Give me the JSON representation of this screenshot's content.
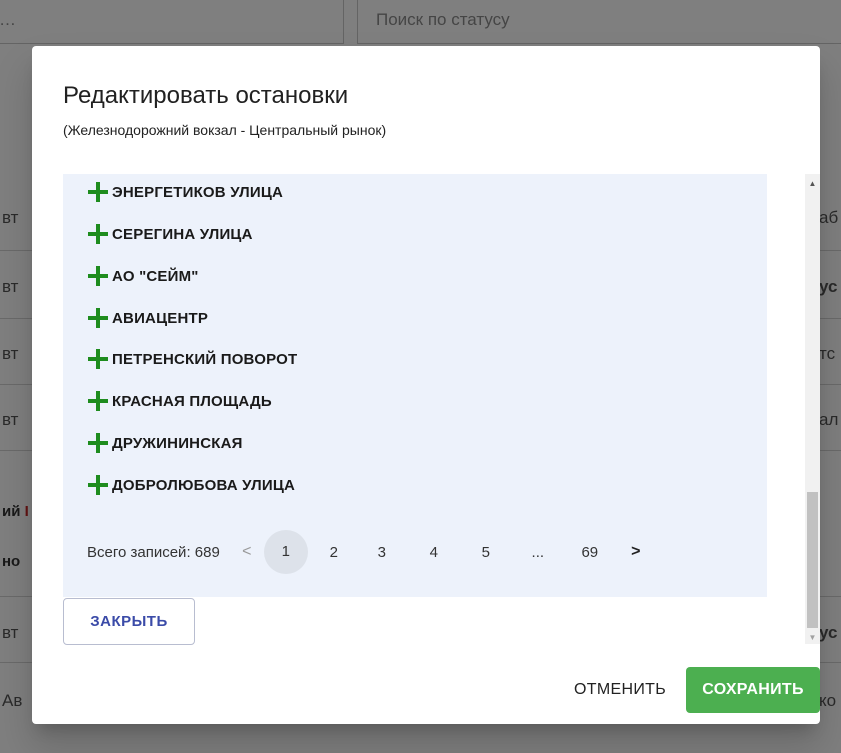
{
  "background": {
    "search_left": "…",
    "search_right": "Поиск по статусу",
    "rows": [
      {
        "left": "вт",
        "right": "аб"
      },
      {
        "left": "вт",
        "right": "ус"
      },
      {
        "left": "вт",
        "right": "тс"
      },
      {
        "left": "вт",
        "right": "ал"
      },
      {
        "left_bold": "ий",
        "left_red": "I",
        "right": ""
      },
      {
        "left_bold": "но",
        "right": ""
      },
      {
        "left": "вт",
        "right": "ус"
      },
      {
        "left": "Ав",
        "right": "ко"
      }
    ]
  },
  "dialog": {
    "title": "Редактировать остановки",
    "subtitle": "(Железнодорожний вокзал - Центральный рынок)",
    "stops": [
      "ЭНЕРГЕТИКОВ УЛИЦА",
      "СЕРЕГИНА УЛИЦА",
      "АО \"СЕЙМ\"",
      "АВИАЦЕНТР",
      "ПЕТРЕНСКИЙ ПОВОРОТ",
      "КРАСНАЯ ПЛОЩАДЬ",
      "ДРУЖИНИНСКАЯ",
      "ДОБРОЛЮБОВА УЛИЦА"
    ],
    "pagination": {
      "total_label": "Всего записей: 689",
      "prev": "<",
      "current": "1",
      "pages": [
        "2",
        "3",
        "4",
        "5"
      ],
      "ellipsis": "...",
      "last": "69",
      "next": ">"
    },
    "close_label": "ЗАКРЫТЬ",
    "cancel_label": "ОТМЕНИТЬ",
    "save_label": "СОХРАНИТЬ"
  },
  "colors": {
    "accent_green": "#4caf50",
    "plus_icon": "#1e8c1e",
    "close_text": "#3b4ba8",
    "panel_bg": "#edf2fb"
  }
}
